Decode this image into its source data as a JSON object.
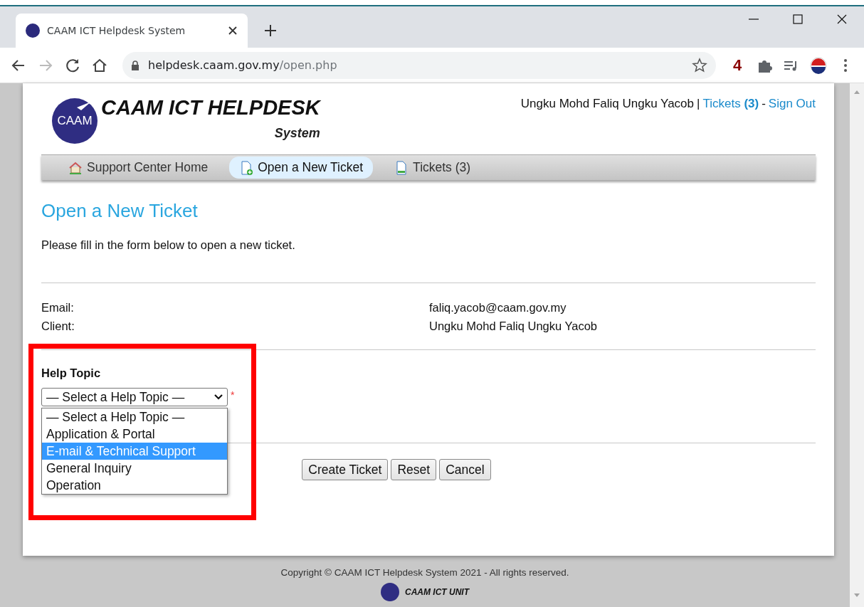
{
  "browser": {
    "tab_title": "CAAM ICT Helpdesk System",
    "url_host": "helpdesk.caam.gov.my",
    "url_path": "/open.php",
    "extension_badge": "4"
  },
  "header": {
    "logo_text": "CAAM",
    "title": "CAAM ICT HELPDESK",
    "subtitle": "System",
    "user": "Ungku Mohd Faliq Ungku Yacob",
    "separator": "|",
    "tickets_link": "Tickets **(3)**",
    "dash": "-",
    "sign_out": "Sign Out"
  },
  "nav": [
    {
      "label": "Support Center Home",
      "kind": "home",
      "selected": false
    },
    {
      "label": "Open a New Ticket",
      "kind": "new",
      "selected": true
    },
    {
      "label": "Tickets (3)",
      "kind": "doc",
      "selected": false
    }
  ],
  "page": {
    "heading": "Open a New Ticket",
    "intro": "Please fill in the form below to open a new ticket."
  },
  "fields": [
    {
      "label": "Email:",
      "value": "faliq.yacob@caam.gov.my"
    },
    {
      "label": "Client:",
      "value": "Ungku Mohd Faliq Ungku Yacob"
    }
  ],
  "help_topic": {
    "label": "Help Topic",
    "value": "— Select a Help Topic —",
    "required": "*",
    "expanded": true,
    "options": [
      {
        "label": "— Select a Help Topic —",
        "highlighted": false
      },
      {
        "label": "Application & Portal",
        "highlighted": false
      },
      {
        "label": "E-mail & Technical Support",
        "highlighted": true
      },
      {
        "label": "General Inquiry",
        "highlighted": false
      },
      {
        "label": "Operation",
        "highlighted": false
      }
    ]
  },
  "buttons": [
    "Create Ticket",
    "Reset",
    "Cancel"
  ],
  "footer": {
    "copyright": "Copyright © CAAM ICT Helpdesk System 2021 - All rights reserved.",
    "unit": "CAAM ICT UNIT"
  }
}
